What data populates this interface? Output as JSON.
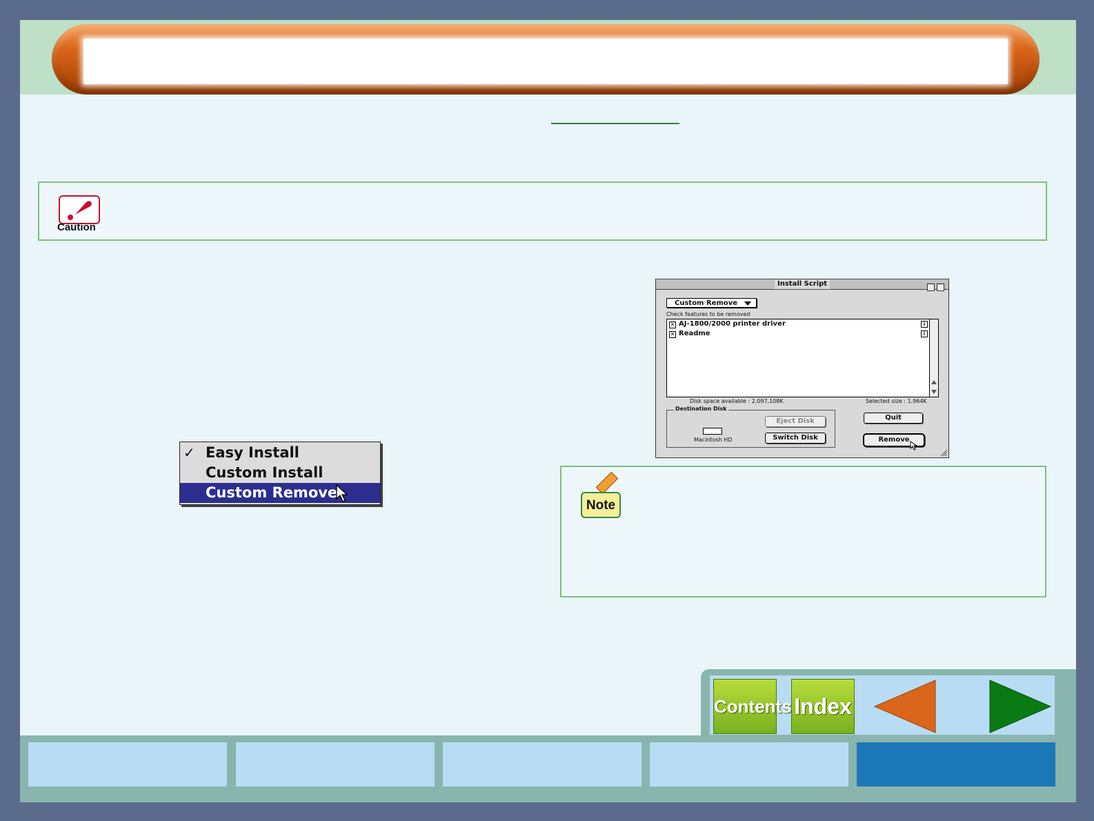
{
  "caution": {
    "label": "Caution"
  },
  "menu": {
    "items": [
      {
        "label": "Easy Install",
        "checked": true
      },
      {
        "label": "Custom Install"
      },
      {
        "label": "Custom Remove",
        "selected": true
      }
    ]
  },
  "dialog": {
    "title": "Install Script",
    "popup_value": "Custom Remove",
    "check_label": "Check features to be removed",
    "items": [
      {
        "label": "AJ-1800/2000 printer driver",
        "checked": true
      },
      {
        "label": "Readme",
        "checked": true
      }
    ],
    "disk_space": "Disk space available : 2,097,108K",
    "selected_size": "Selected size : 1,964K",
    "destination_label": "Destination Disk",
    "disk_name": "Macintosh HD",
    "eject_label": "Eject Disk",
    "switch_label": "Switch Disk",
    "quit_label": "Quit",
    "remove_label": "Remove"
  },
  "note": {
    "label": "Note"
  },
  "nav": {
    "contents_label": "Contents",
    "index_label": "Index"
  },
  "colors": {
    "accent_orange": "#d9661a",
    "nav_green": "#8bbf26",
    "tab_active": "#1c78b8",
    "back_arrow": "#d9661a",
    "forward_arrow": "#0a7a12"
  }
}
